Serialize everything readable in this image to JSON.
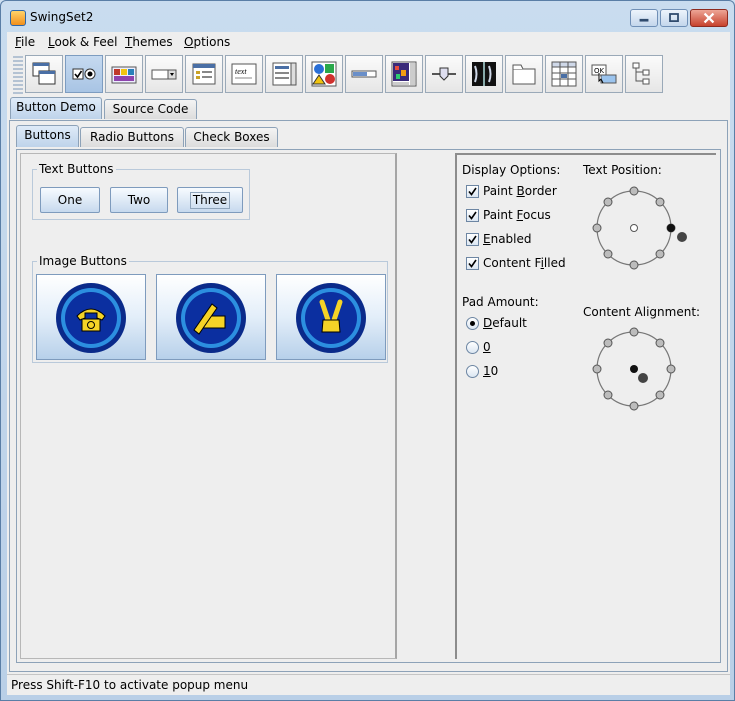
{
  "window": {
    "title": "SwingSet2"
  },
  "menubar": {
    "items": [
      {
        "label": "File",
        "mnemonic": "F",
        "rest": "ile"
      },
      {
        "label": "Look & Feel",
        "mnemonic": "L",
        "rest": "ook & Feel"
      },
      {
        "label": "Themes",
        "mnemonic": "T",
        "rest": "hemes"
      },
      {
        "label": "Options",
        "mnemonic": "O",
        "rest": "ptions"
      }
    ]
  },
  "toolbar": {
    "tools": [
      "internal-frame-icon",
      "button-icon",
      "color-chooser-icon",
      "combobox-icon",
      "file-chooser-icon",
      "editor-pane-icon",
      "list-icon",
      "option-pane-icon",
      "progress-bar-icon",
      "scroll-pane-icon",
      "slider-icon",
      "split-pane-icon",
      "tabbed-pane-icon",
      "table-icon",
      "tooltip-icon",
      "tree-icon"
    ],
    "selected_index": 1,
    "tooltip_sample_text": "OK",
    "editor_sample_text": "text"
  },
  "main_tabs": [
    {
      "label": "Button Demo",
      "active": true
    },
    {
      "label": "Source Code",
      "active": false
    }
  ],
  "inner_tabs": [
    {
      "label": "Buttons",
      "active": true
    },
    {
      "label": "Radio Buttons",
      "active": false
    },
    {
      "label": "Check Boxes",
      "active": false
    }
  ],
  "text_buttons": {
    "title": "Text Buttons",
    "buttons": [
      "One",
      "Two",
      "Three"
    ]
  },
  "image_buttons": {
    "title": "Image Buttons",
    "icons": [
      "phone-icon",
      "write-icon",
      "peace-icon"
    ]
  },
  "display_options": {
    "title": "Display Options:",
    "items": [
      {
        "before": "Paint ",
        "mnemonic": "B",
        "after": "order",
        "checked": true
      },
      {
        "before": "Paint ",
        "mnemonic": "F",
        "after": "ocus",
        "checked": true
      },
      {
        "before": "",
        "mnemonic": "E",
        "after": "nabled",
        "checked": true
      },
      {
        "before": "Content F",
        "mnemonic": "i",
        "after": "lled",
        "checked": true
      }
    ]
  },
  "pad_amount": {
    "title": "Pad Amount:",
    "options": [
      {
        "mnemonic": "D",
        "after": "efault",
        "selected": true
      },
      {
        "mnemonic": "0",
        "after": "",
        "selected": false
      },
      {
        "mnemonic": "1",
        "after": "0",
        "selected": false
      }
    ]
  },
  "text_position": {
    "title": "Text Position:"
  },
  "content_alignment": {
    "title": "Content Alignment:"
  },
  "status": {
    "text": "Press Shift-F10 to activate popup menu"
  }
}
